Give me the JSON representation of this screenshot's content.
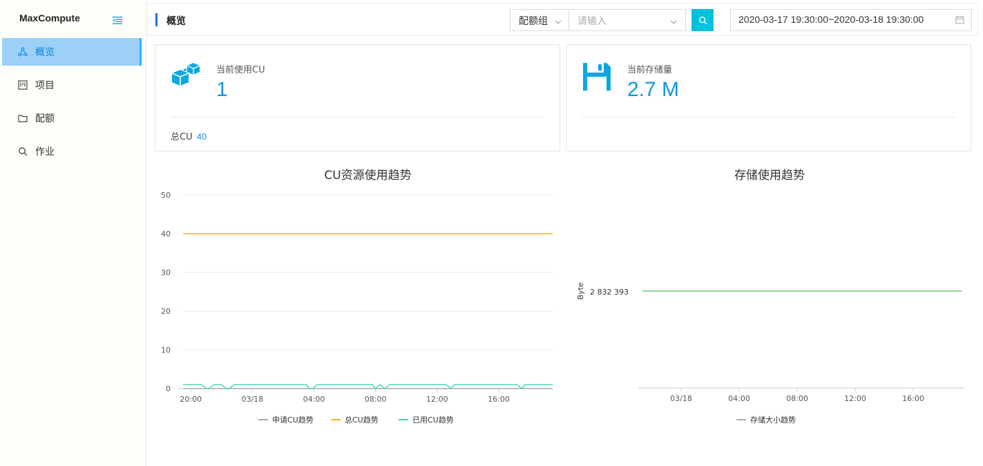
{
  "sidebar": {
    "brand": "MaxCompute",
    "items": [
      {
        "label": "概览",
        "icon": "cluster-icon",
        "active": true
      },
      {
        "label": "项目",
        "icon": "project-icon",
        "active": false
      },
      {
        "label": "配额",
        "icon": "folder-icon",
        "active": false
      },
      {
        "label": "作业",
        "icon": "search-icon",
        "active": false
      }
    ]
  },
  "header": {
    "title": "概览",
    "quota_select": "配额组",
    "search_placeholder": "请输入",
    "date_range": "2020-03-17 19:30:00~2020-03-18 19:30:00"
  },
  "cards": {
    "cu": {
      "label": "当前使用CU",
      "value": "1",
      "footer_label": "总CU",
      "footer_value": "40"
    },
    "storage": {
      "label": "当前存储量",
      "value": "2.7 M"
    }
  },
  "colors": {
    "accent": "#00c1de",
    "value_blue": "#1296db",
    "total_cu": "#f5b324",
    "used_cu": "#3ad6b6",
    "applied_cu": "#a6aab4",
    "storage": "#6cc77a"
  },
  "chart_data": [
    {
      "type": "line",
      "title": "CU资源使用趋势",
      "ylim": [
        0,
        50
      ],
      "yticks": [
        0,
        10,
        20,
        30,
        40,
        50
      ],
      "x_ticks": [
        "20:00",
        "03/18",
        "04:00",
        "08:00",
        "12:00",
        "16:00"
      ],
      "x_tick_hours": [
        0.5,
        4.5,
        8.5,
        12.5,
        16.5,
        20.5
      ],
      "x_range_hours": [
        0,
        24
      ],
      "legend": [
        "申请CU趋势",
        "总CU趋势",
        "已用CU趋势"
      ],
      "series": [
        {
          "name": "申请CU趋势",
          "color": "#a6aab4",
          "x": [
            0,
            24
          ],
          "y": [
            0,
            0
          ]
        },
        {
          "name": "总CU趋势",
          "color": "#f5b324",
          "x": [
            0,
            24
          ],
          "y": [
            40,
            40
          ]
        },
        {
          "name": "已用CU趋势",
          "color": "#3ad6b6",
          "x": [
            0,
            1.2,
            1.5,
            1.7,
            2.0,
            2.5,
            2.8,
            3.0,
            3.3,
            8.0,
            8.2,
            8.4,
            8.7,
            8.9,
            12.3,
            12.5,
            12.8,
            13.1,
            13.4,
            17.1,
            17.4,
            17.6,
            21.7,
            22.0,
            22.2,
            24
          ],
          "y": [
            1,
            1,
            0,
            0,
            1,
            1,
            0,
            0,
            1,
            1,
            0,
            0,
            1,
            1,
            1,
            0,
            1,
            0,
            1,
            1,
            0,
            1,
            1,
            0,
            1,
            1
          ]
        }
      ]
    },
    {
      "type": "line",
      "title": "存储使用趋势",
      "ylabel": "Byte",
      "yticks_labels": [
        "2 832 393"
      ],
      "x_ticks": [
        "03/18",
        "04:00",
        "08:00",
        "12:00",
        "16:00"
      ],
      "legend": [
        "存储大小趋势"
      ],
      "series": [
        {
          "name": "存储大小趋势",
          "color": "#6cc77a",
          "y_const": 2832393
        }
      ]
    }
  ]
}
